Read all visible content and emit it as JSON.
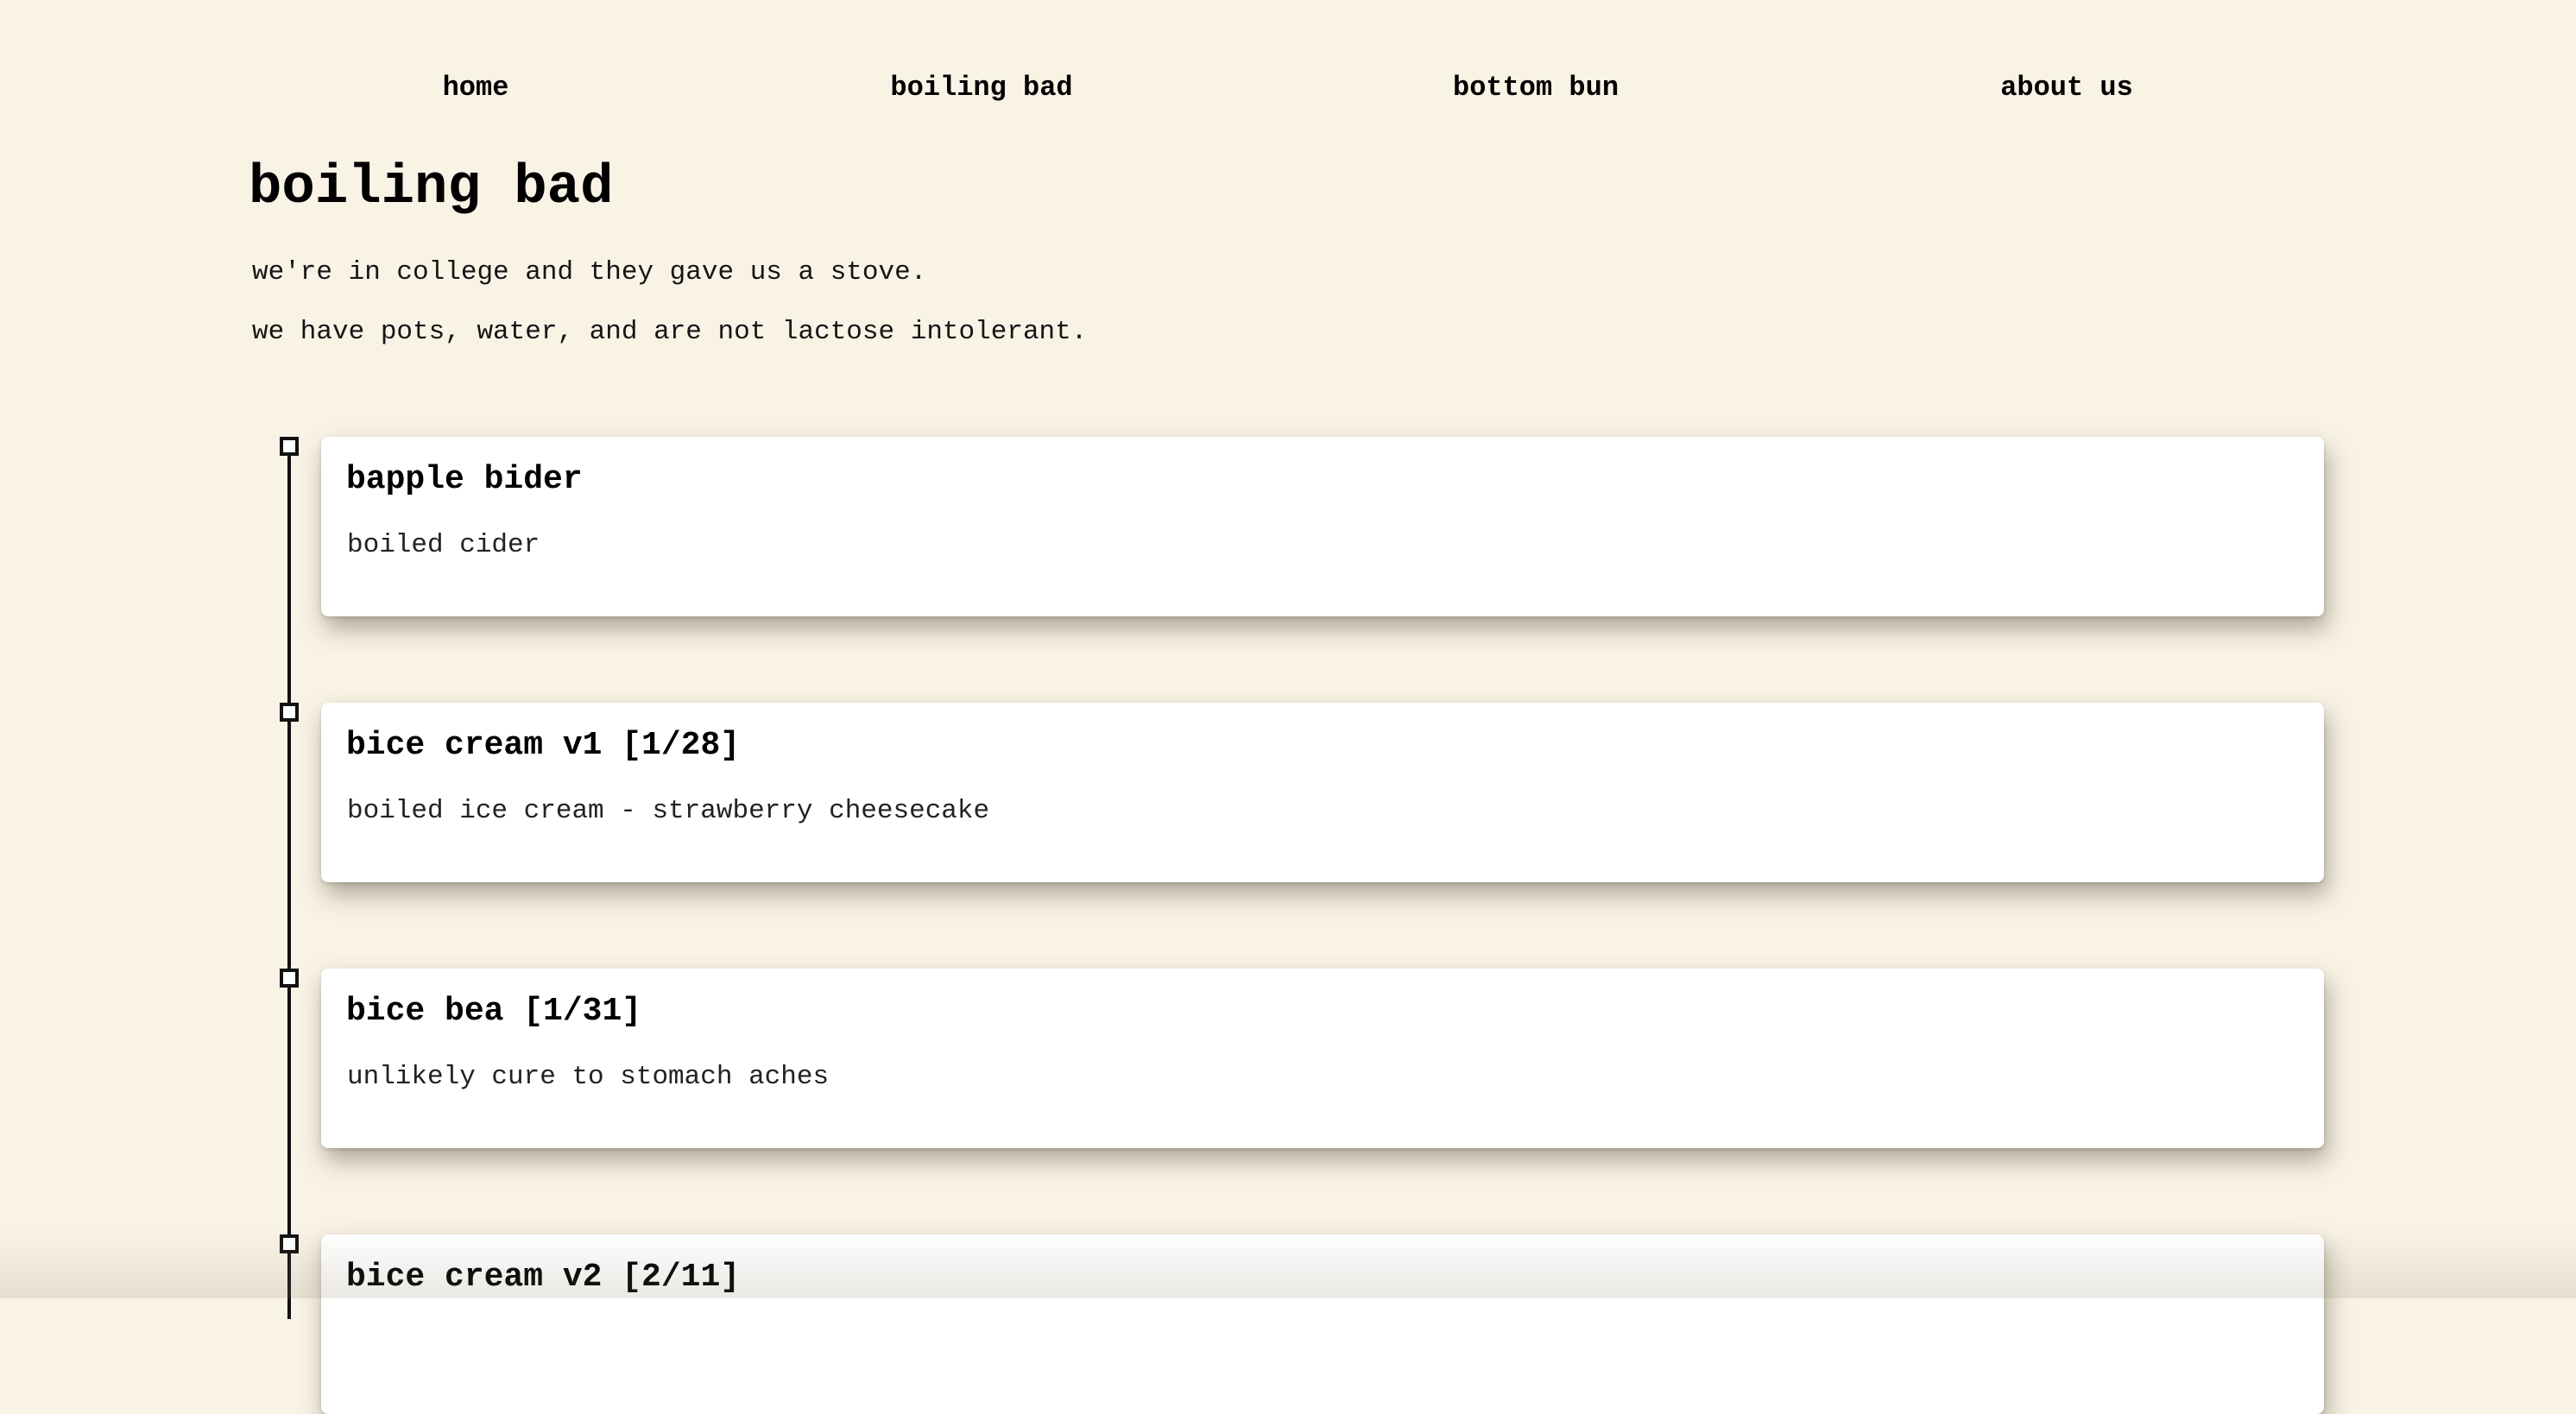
{
  "nav": {
    "items": [
      {
        "label": "home"
      },
      {
        "label": "boiling bad"
      },
      {
        "label": "bottom bun"
      },
      {
        "label": "about us"
      }
    ]
  },
  "page": {
    "title": "boiling bad",
    "intro": [
      "we're in college and they gave us a stove.",
      "we have pots, water, and are not lactose intolerant."
    ]
  },
  "timeline": {
    "entries": [
      {
        "title": "bapple bider",
        "description": "boiled cider"
      },
      {
        "title": "bice cream v1 [1/28]",
        "description": "boiled ice cream - strawberry cheesecake"
      },
      {
        "title": "bice bea [1/31]",
        "description": "unlikely cure to stomach aches"
      },
      {
        "title": "bice cream v2 [2/11]",
        "description": ""
      }
    ]
  },
  "colors": {
    "background": "#f9f3e6",
    "card": "#ffffff",
    "text": "#111111"
  }
}
